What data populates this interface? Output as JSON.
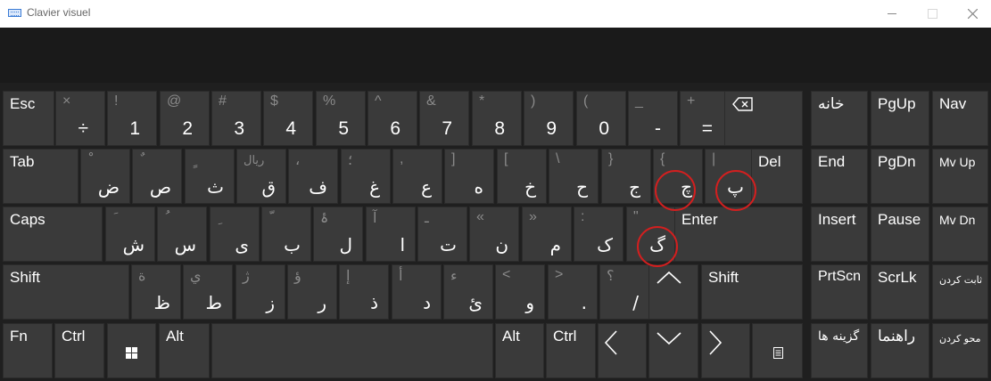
{
  "window": {
    "title": "Clavier visuel"
  },
  "row1": {
    "esc": "Esc",
    "keys": [
      {
        "shift": "×",
        "base": "÷"
      },
      {
        "shift": "!",
        "base": "1"
      },
      {
        "shift": "@",
        "base": "2"
      },
      {
        "shift": "#",
        "base": "3"
      },
      {
        "shift": "$",
        "base": "4"
      },
      {
        "shift": "%",
        "base": "5"
      },
      {
        "shift": "^",
        "base": "6"
      },
      {
        "shift": "&",
        "base": "7"
      },
      {
        "shift": "*",
        "base": "8"
      },
      {
        "shift": ")",
        "base": "9"
      },
      {
        "shift": "(",
        "base": "0"
      },
      {
        "shift": "_",
        "base": "-"
      },
      {
        "shift": "+",
        "base": "="
      }
    ],
    "backspace_icon": "backspace-icon"
  },
  "row2": {
    "tab": "Tab",
    "keys": [
      {
        "shift": "ْ",
        "base": "ض"
      },
      {
        "shift": "ٌ",
        "base": "ص"
      },
      {
        "shift": "ٍ",
        "base": "ث"
      },
      {
        "shift": "ریال",
        "base": "ق"
      },
      {
        "shift": "،",
        "base": "ف"
      },
      {
        "shift": "؛",
        "base": "غ"
      },
      {
        "shift": ",",
        "base": "ع"
      },
      {
        "shift": "]",
        "base": "ه"
      },
      {
        "shift": "[",
        "base": "خ"
      },
      {
        "shift": "\\",
        "base": "ح"
      },
      {
        "shift": "}",
        "base": "ج"
      },
      {
        "shift": "{",
        "base": "چ"
      },
      {
        "shift": "|",
        "base": "پ"
      }
    ],
    "del": "Del"
  },
  "row3": {
    "caps": "Caps",
    "keys": [
      {
        "shift": "َ",
        "base": "ش"
      },
      {
        "shift": "ُ",
        "base": "س"
      },
      {
        "shift": "ِ",
        "base": "ی"
      },
      {
        "shift": "ّ",
        "base": "ب"
      },
      {
        "shift": "ۀ",
        "base": "ل"
      },
      {
        "shift": "آ",
        "base": "ا"
      },
      {
        "shift": "ـ",
        "base": "ت"
      },
      {
        "shift": "«",
        "base": "ن"
      },
      {
        "shift": "»",
        "base": "م"
      },
      {
        "shift": ":",
        "base": "ک"
      },
      {
        "shift": "\"",
        "base": "گ"
      }
    ],
    "enter": "Enter"
  },
  "row4": {
    "shift_left": "Shift",
    "keys": [
      {
        "shift": "ة",
        "base": "ظ"
      },
      {
        "shift": "ي",
        "base": "ط"
      },
      {
        "shift": "ژ",
        "base": "ز"
      },
      {
        "shift": "ؤ",
        "base": "ر"
      },
      {
        "shift": "إ",
        "base": "ذ"
      },
      {
        "shift": "أ",
        "base": "د"
      },
      {
        "shift": "ء",
        "base": "ئ"
      },
      {
        "shift": "<",
        "base": "و"
      },
      {
        "shift": ">",
        "base": "."
      },
      {
        "shift": "؟",
        "base": "/"
      }
    ],
    "shift_right": "Shift"
  },
  "row5": {
    "fn": "Fn",
    "ctrl_left": "Ctrl",
    "alt_left": "Alt",
    "alt_right": "Alt",
    "ctrl_right": "Ctrl"
  },
  "nav": {
    "home": "خانه",
    "pgup": "PgUp",
    "nav": "Nav",
    "end": "End",
    "pgdn": "PgDn",
    "mvup": "Mv Up",
    "insert": "Insert",
    "pause": "Pause",
    "mvdn": "Mv Dn",
    "prtscn": "PrtScn",
    "scrlk": "ScrLk",
    "dock": "ثابت کردن",
    "options": "گزینه ها",
    "help": "راهنما",
    "fade": "محو کردن"
  },
  "highlight_color": "#d31f1f"
}
